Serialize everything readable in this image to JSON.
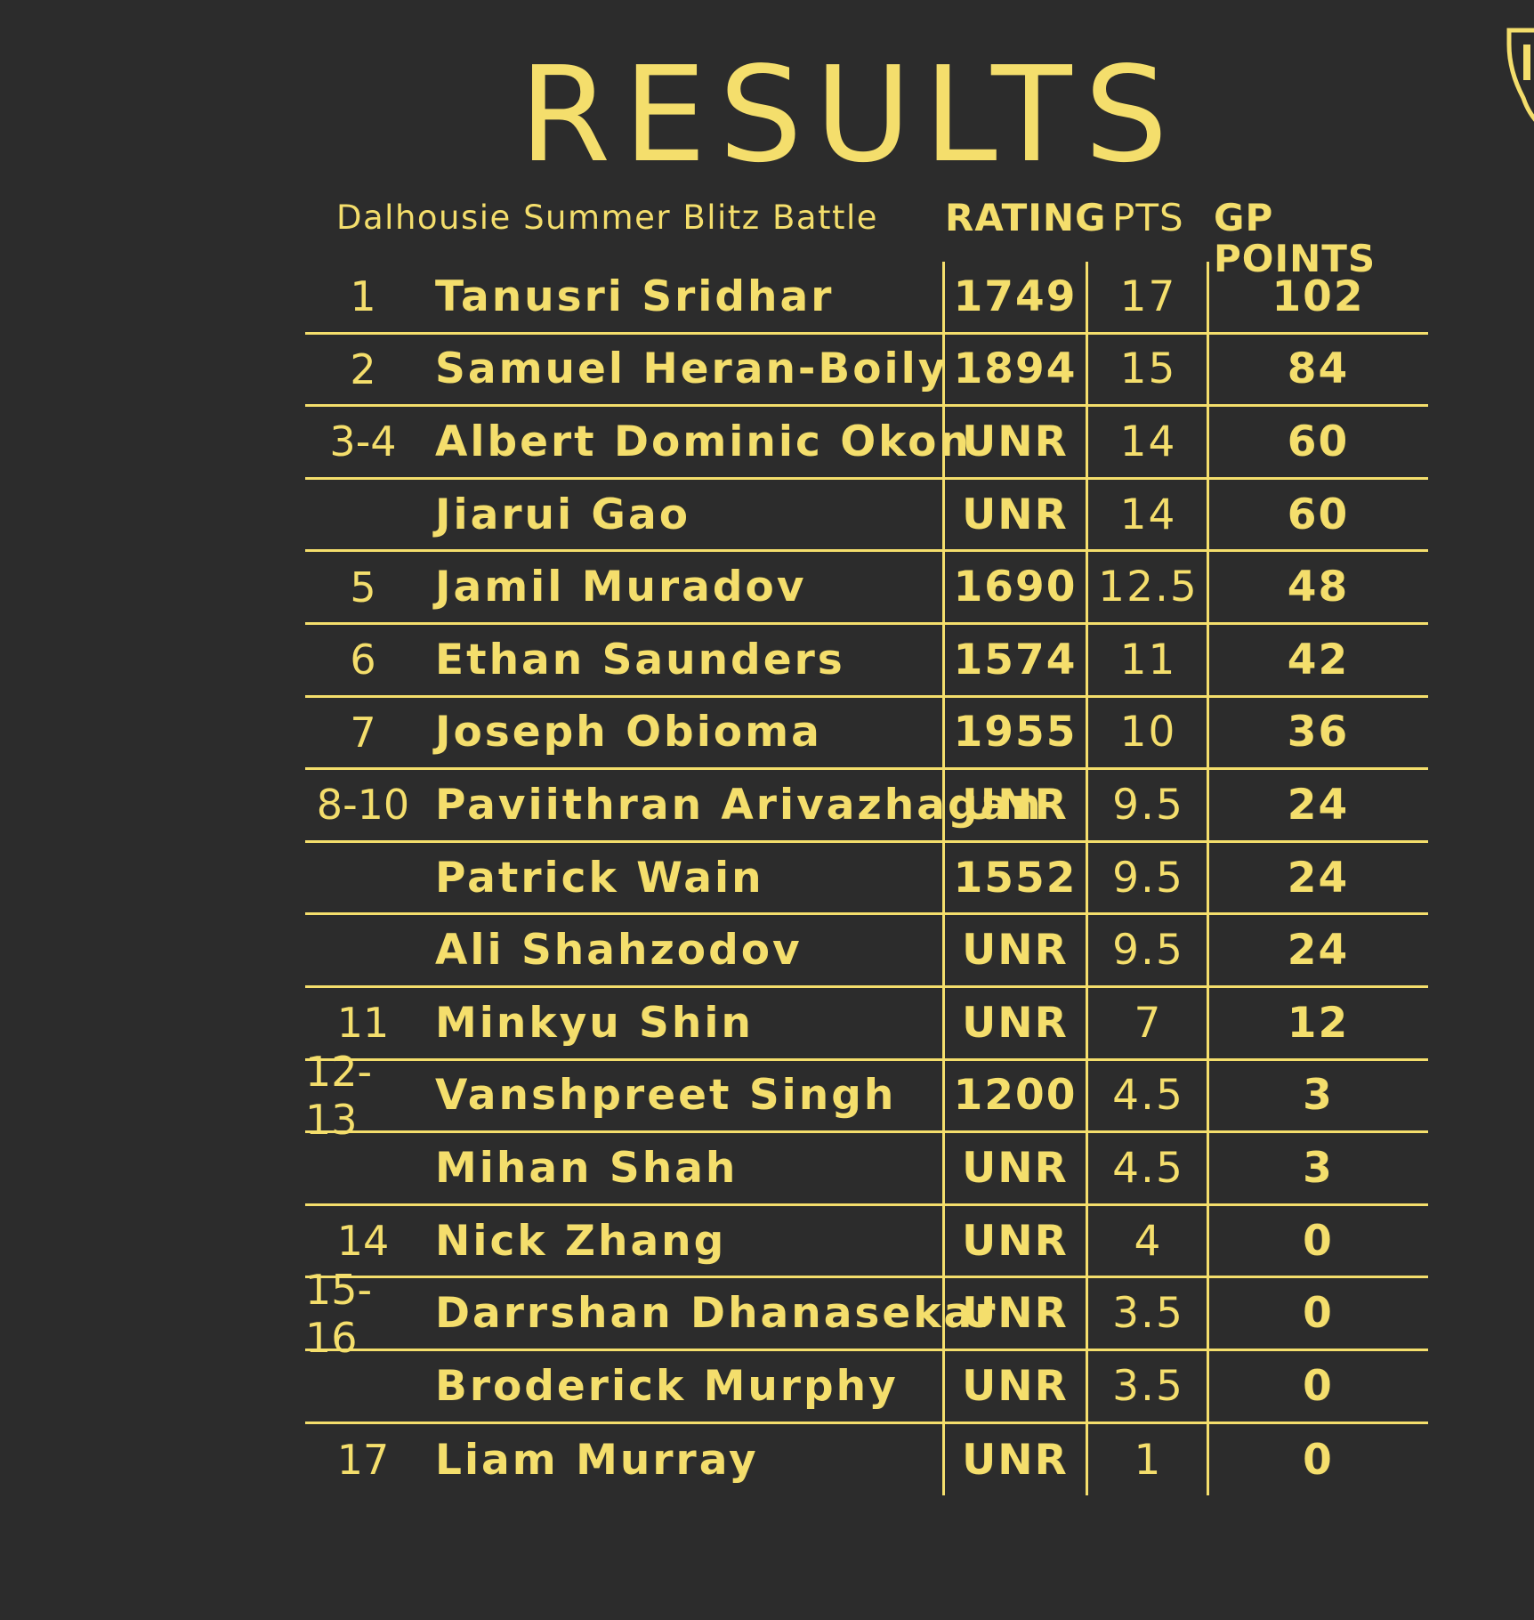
{
  "title": "RESULTS",
  "headers": {
    "event": "Dalhousie Summer Blitz Battle",
    "rating": "RATING",
    "pts": "PTS",
    "gp": "GP POINTS"
  },
  "colors": {
    "background": "#2c2c2c",
    "accent": "#f4de6c"
  },
  "rows": [
    {
      "rank": "1",
      "name": "Tanusri Sridhar",
      "rating": "1749",
      "pts": "17",
      "gp": "102"
    },
    {
      "rank": "2",
      "name": "Samuel Heran-Boily",
      "rating": "1894",
      "pts": "15",
      "gp": "84"
    },
    {
      "rank": "3-4",
      "name": "Albert Dominic Okon",
      "rating": "UNR",
      "pts": "14",
      "gp": "60"
    },
    {
      "rank": "",
      "name": "Jiarui Gao",
      "rating": "UNR",
      "pts": "14",
      "gp": "60"
    },
    {
      "rank": "5",
      "name": "Jamil Muradov",
      "rating": "1690",
      "pts": "12.5",
      "gp": "48"
    },
    {
      "rank": "6",
      "name": "Ethan Saunders",
      "rating": "1574",
      "pts": "11",
      "gp": "42"
    },
    {
      "rank": "7",
      "name": "Joseph Obioma",
      "rating": "1955",
      "pts": "10",
      "gp": "36"
    },
    {
      "rank": "8-10",
      "name": "Paviithran Arivazhagan",
      "rating": "UNR",
      "pts": "9.5",
      "gp": "24"
    },
    {
      "rank": "",
      "name": "Patrick Wain",
      "rating": "1552",
      "pts": "9.5",
      "gp": "24"
    },
    {
      "rank": "",
      "name": "Ali Shahzodov",
      "rating": "UNR",
      "pts": "9.5",
      "gp": "24"
    },
    {
      "rank": "11",
      "name": "Minkyu Shin",
      "rating": "UNR",
      "pts": "7",
      "gp": "12"
    },
    {
      "rank": "12-13",
      "name": "Vanshpreet Singh",
      "rating": "1200",
      "pts": "4.5",
      "gp": "3"
    },
    {
      "rank": "",
      "name": "Mihan Shah",
      "rating": "UNR",
      "pts": "4.5",
      "gp": "3"
    },
    {
      "rank": "14",
      "name": "Nick Zhang",
      "rating": "UNR",
      "pts": "4",
      "gp": "0"
    },
    {
      "rank": "15-16",
      "name": "Darrshan Dhanasekar",
      "rating": "UNR",
      "pts": "3.5",
      "gp": "0"
    },
    {
      "rank": "",
      "name": "Broderick Murphy",
      "rating": "UNR",
      "pts": "3.5",
      "gp": "0"
    },
    {
      "rank": "17",
      "name": "Liam Murray",
      "rating": "UNR",
      "pts": "1",
      "gp": "0"
    }
  ],
  "crest_icon": "shield-crest-icon"
}
